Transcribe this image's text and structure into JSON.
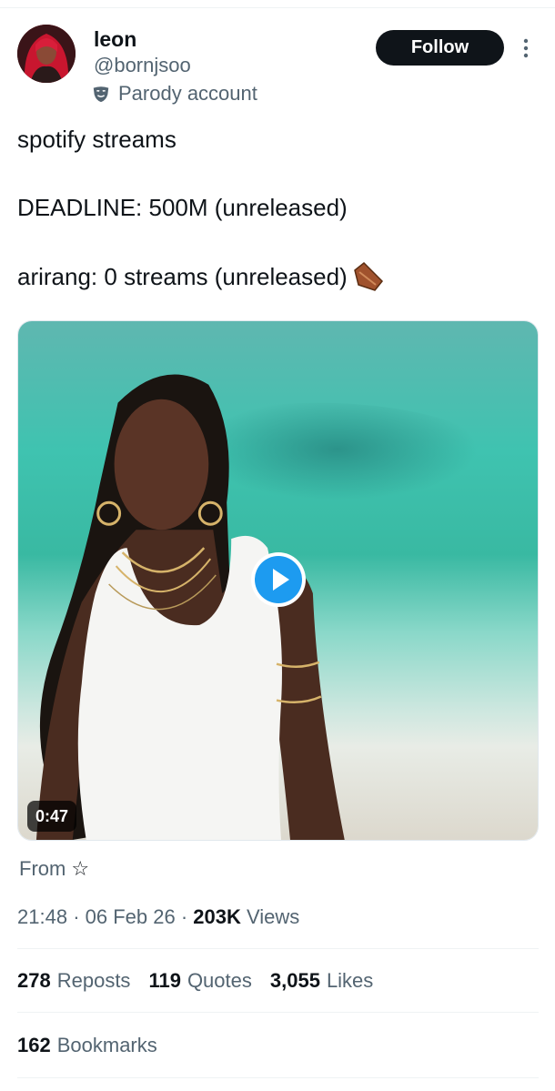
{
  "author": {
    "display_name": "leon",
    "handle": "@bornjsoo",
    "label": "Parody account",
    "follow_label": "Follow"
  },
  "tweet": {
    "line1": "spotify streams",
    "line2": "DEADLINE: 500M (unreleased)",
    "line3": "arirang: 0 streams (unreleased)",
    "line3_emoji": "coffin-icon"
  },
  "media": {
    "type": "video",
    "duration": "0:47",
    "play_icon": "play-icon"
  },
  "source": {
    "from_label": "From",
    "from_icon": "star-icon"
  },
  "meta": {
    "time": "21:48",
    "separator": "·",
    "date": "06 Feb 26",
    "views_count": "203K",
    "views_label": "Views"
  },
  "stats": {
    "reposts_count": "278",
    "reposts_label": "Reposts",
    "quotes_count": "119",
    "quotes_label": "Quotes",
    "likes_count": "3,055",
    "likes_label": "Likes",
    "bookmarks_count": "162",
    "bookmarks_label": "Bookmarks"
  },
  "colors": {
    "text_primary": "#0f1419",
    "text_secondary": "#536471",
    "follow_bg": "#0f1419",
    "play_blue": "#1d9bf0"
  }
}
